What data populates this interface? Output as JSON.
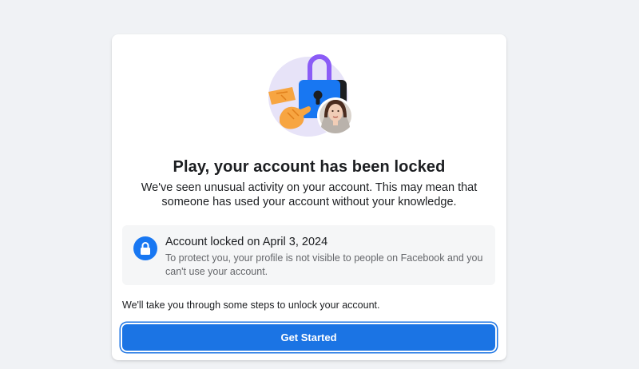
{
  "card": {
    "illustration": {
      "icon_names": [
        "lock-icon",
        "hands-icon",
        "profile-avatar"
      ],
      "colors": {
        "circle": "#e7e3f8",
        "lock_body": "#1877f2",
        "lock_shackle": "#8b5cf6",
        "hands": "#f7a541"
      }
    },
    "title": "Play, your account has been locked",
    "subtitle": "We've seen unusual activity on your account. This may mean that someone has used your account without your knowledge.",
    "notice": {
      "icon": "lock-icon",
      "title": "Account locked on April 3, 2024",
      "text": "To protect you, your profile is not visible to people on Facebook and you can't use your account."
    },
    "steps_text": "We'll take you through some steps to unlock your account.",
    "primary_button": "Get Started"
  },
  "colors": {
    "background": "#f0f2f5",
    "accent": "#1b74e4",
    "secondary_text": "#65676b"
  }
}
